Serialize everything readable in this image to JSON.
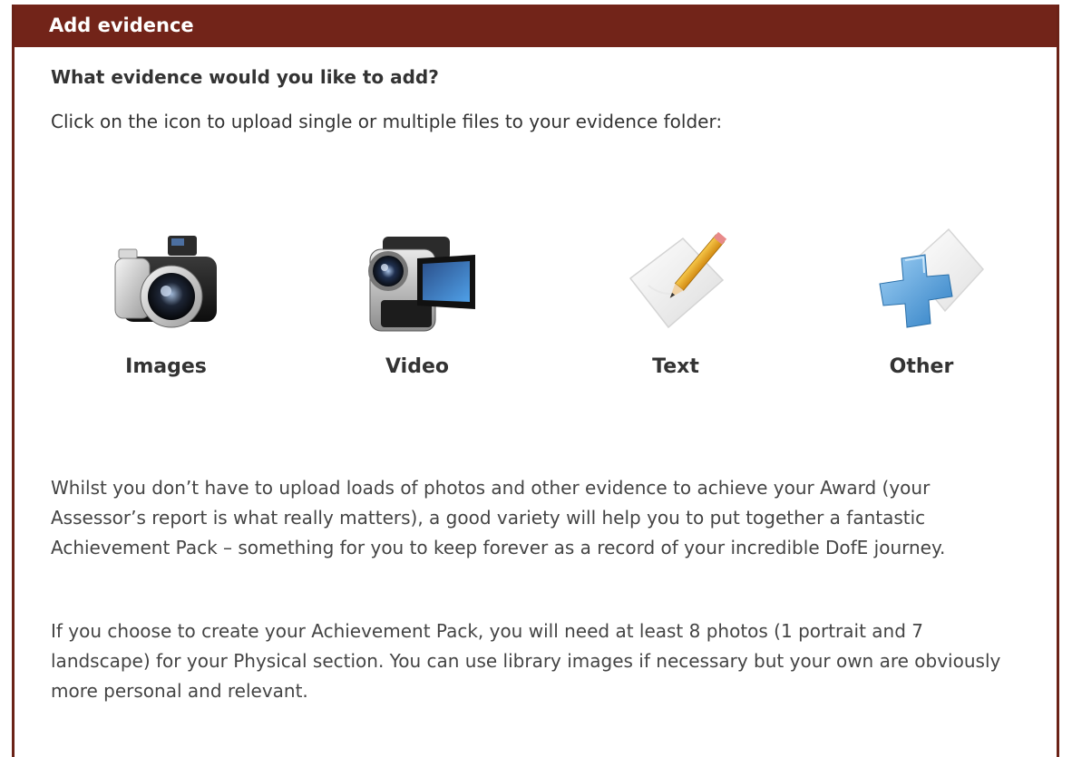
{
  "panel": {
    "title": "Add evidence",
    "question": "What evidence would you like to add?",
    "instruction": "Click on the icon to upload single or multiple files to your evidence folder:"
  },
  "options": [
    {
      "label": "Images",
      "icon": "camera-icon"
    },
    {
      "label": "Video",
      "icon": "video-camera-icon"
    },
    {
      "label": "Text",
      "icon": "pencil-paper-icon"
    },
    {
      "label": "Other",
      "icon": "plus-icon"
    }
  ],
  "body": {
    "paragraph1": "Whilst you don’t have to upload loads of photos and other evidence to achieve your Award (your Assessor’s report is what really matters), a good variety will help you to put together a fantastic Achievement Pack – something for you to keep forever as a record of your incredible DofE journey.",
    "paragraph2": "If you choose to create your Achievement Pack, you will need at least 8 photos (1 portrait and 7 landscape) for your Physical section. You can use library images if necessary but your own are obviously more personal and relevant."
  },
  "colors": {
    "header_bg": "#722419",
    "header_text": "#ffffff",
    "text": "#333333"
  }
}
